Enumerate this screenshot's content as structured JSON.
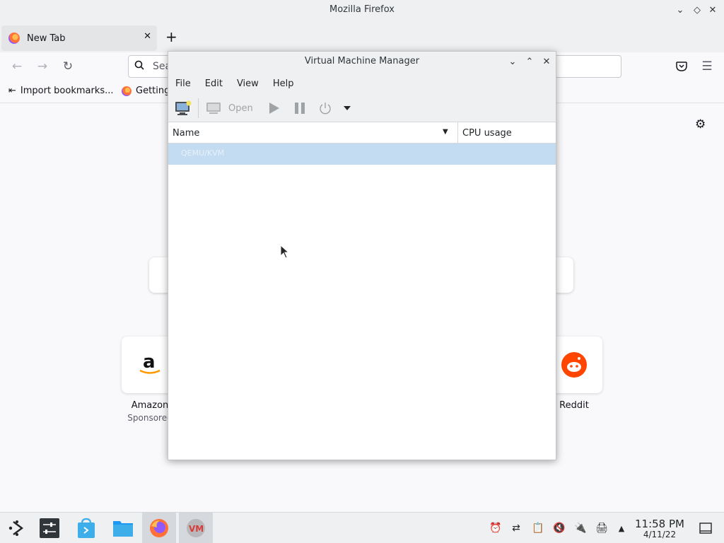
{
  "firefox": {
    "window_title": "Mozilla Firefox",
    "tab_label": "New Tab",
    "url_placeholder": "Sea",
    "bookmarks": [
      "Import bookmarks...",
      "Getting"
    ],
    "tiles": [
      {
        "label": "Amazon",
        "sub": "Sponsored"
      },
      {
        "label": "Reddit",
        "sub": ""
      }
    ]
  },
  "vmm": {
    "title": "Virtual Machine Manager",
    "menu": [
      "File",
      "Edit",
      "View",
      "Help"
    ],
    "toolbar": {
      "open_label": "Open"
    },
    "columns": {
      "name": "Name",
      "cpu": "CPU usage"
    },
    "rows": [
      "QEMU/KVM"
    ]
  },
  "taskbar": {
    "time": "11:58 PM",
    "date": "4/11/22"
  },
  "colors": {
    "selection": "#c3dcf1",
    "chrome": "#eff0f1",
    "firefox_orange": "#ff7139",
    "reddit_orange": "#ff4500"
  }
}
